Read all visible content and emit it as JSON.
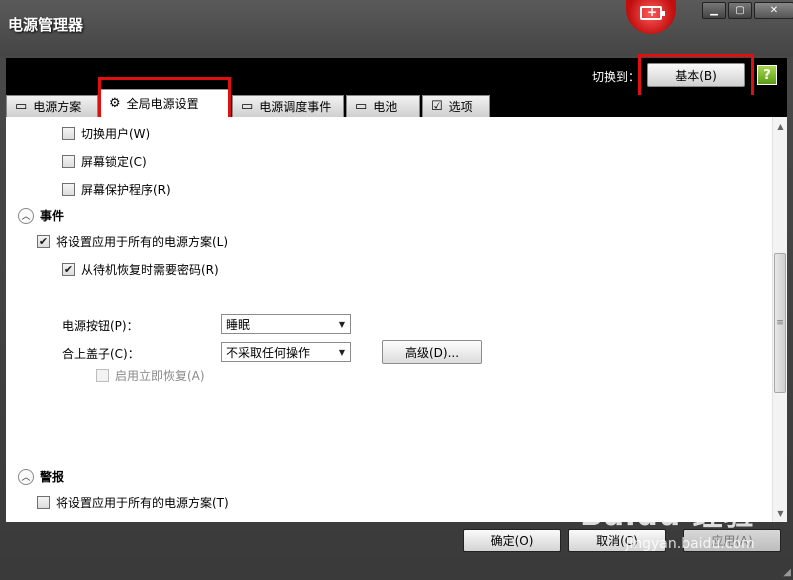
{
  "window": {
    "title": "电源管理器",
    "controls": [
      "minimize",
      "maximize",
      "close"
    ]
  },
  "toolbar": {
    "switch_label": "切换到：",
    "switch_button": "基本(B)",
    "help_icon": "?"
  },
  "tabs": [
    {
      "label": "电源方案",
      "icon": "battery-outline-icon"
    },
    {
      "label": "全局电源设置",
      "icon": "gear-icon",
      "active": true
    },
    {
      "label": "电源调度事件",
      "icon": "battery-clock-icon"
    },
    {
      "label": "电池",
      "icon": "battery-icon"
    },
    {
      "label": "选项",
      "icon": "checkbox-icon"
    }
  ],
  "content": {
    "lock_options": [
      {
        "label": "切换用户(W)",
        "checked": false
      },
      {
        "label": "屏幕锁定(C)",
        "checked": false
      },
      {
        "label": "屏幕保护程序(R)",
        "checked": false
      }
    ],
    "events_section": {
      "title": "事件",
      "apply_all": {
        "label": "将设置应用于所有的电源方案(L)",
        "checked": true
      },
      "require_password": {
        "label": "从待机恢复时需要密码(R)",
        "checked": true
      },
      "power_button": {
        "label": "电源按钮(P)：",
        "value": "睡眠"
      },
      "lid": {
        "label": "合上盖子(C)：",
        "value": "不采取任何操作"
      },
      "advanced_button": "高级(D)...",
      "instant_resume": {
        "label": "启用立即恢复(A)",
        "checked": false,
        "disabled": true
      }
    },
    "alarms_section": {
      "title": "警报",
      "apply_all": {
        "label": "将设置应用于所有的电源方案(T)",
        "checked": false
      }
    }
  },
  "footer": {
    "ok": "确定(O)",
    "cancel": "取消(C)",
    "apply": "应用(A)"
  },
  "watermark": {
    "main": "Baidu 经验",
    "sub": "jingyan.baidu.com"
  },
  "colors": {
    "highlight": "#e01010",
    "chrome": "#3b3b3b",
    "band": "#000000"
  }
}
